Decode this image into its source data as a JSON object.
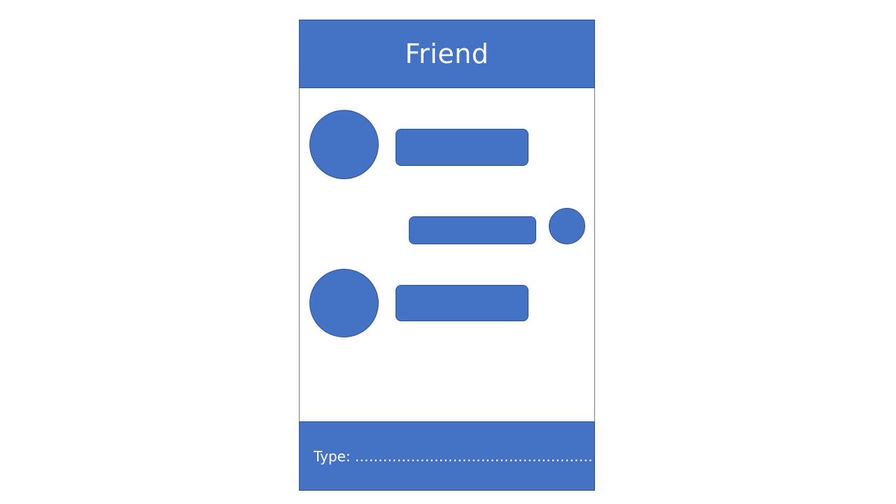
{
  "header": {
    "title": "Friend"
  },
  "messages": [
    {
      "sender": "friend",
      "avatar_icon": "friend-avatar-icon"
    },
    {
      "sender": "self",
      "avatar_icon": "user-avatar-icon"
    },
    {
      "sender": "friend",
      "avatar_icon": "friend-avatar-icon"
    }
  ],
  "composer": {
    "label": "Type:",
    "placeholder": "………………………………………………….."
  },
  "colors": {
    "accent": "#4472c4",
    "accent_border": "#2f528f",
    "frame_border": "#2e9e86",
    "text_on_accent": "#ffffff"
  }
}
